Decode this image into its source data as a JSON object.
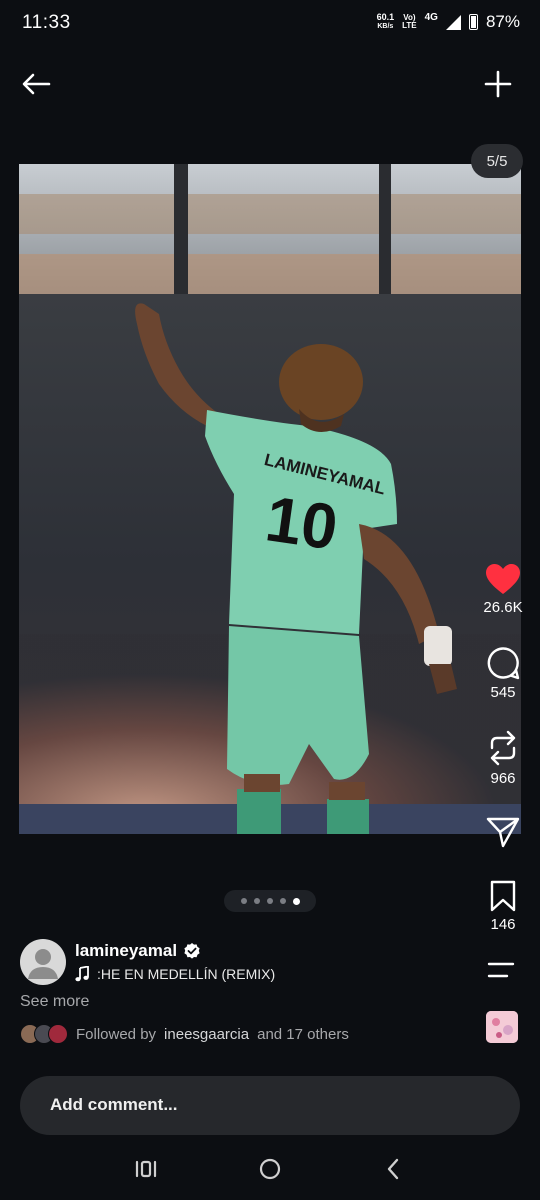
{
  "status": {
    "time": "11:33",
    "net_speed_value": "60.1",
    "net_speed_unit": "KB/s",
    "volte_top": "Vo)",
    "volte_bottom": "LTE",
    "network": "4G",
    "battery": "87%"
  },
  "post": {
    "counter": "5/5",
    "likes": "26.6K",
    "comments": "545",
    "reposts": "966",
    "saves": "146",
    "username": "lamineyamal",
    "music": ":HE EN MEDELLÍN (REMIX)",
    "see_more": "See more",
    "followed_prefix": "Followed by",
    "followed_user": "ineesgaarcia",
    "followed_suffix": "and 17 others",
    "jersey_name": "LAMINEYAMAL",
    "jersey_number": "10",
    "dots_total": 5,
    "dots_active": 5
  },
  "comment": {
    "placeholder": "Add comment..."
  },
  "colors": {
    "like": "#ff3040",
    "background": "#0c0e12",
    "jersey": "#7fcfb0"
  },
  "icons": {
    "back": "arrow-left-icon",
    "add": "plus-icon",
    "like": "heart-icon",
    "comment": "comment-bubble-icon",
    "repost": "repost-icon",
    "share": "send-icon",
    "save": "bookmark-icon",
    "menu": "menu-lines-icon",
    "music": "music-note-icon",
    "verified": "verified-badge-icon"
  }
}
